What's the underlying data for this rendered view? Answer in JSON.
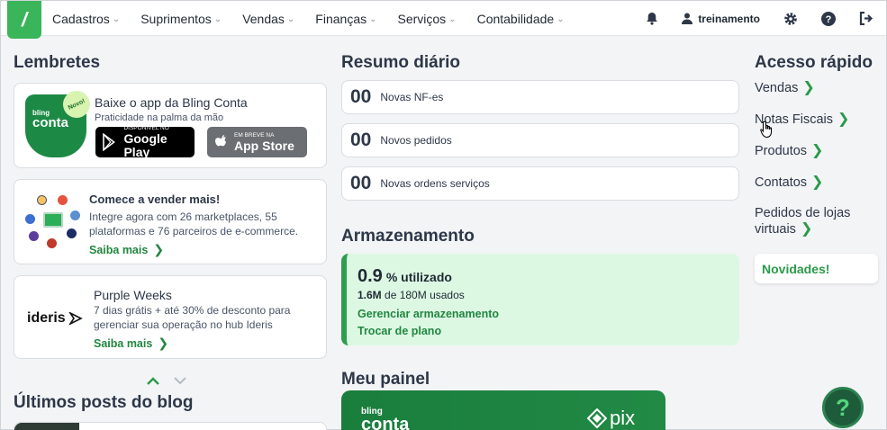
{
  "nav": {
    "items": [
      {
        "label": "Cadastros",
        "name": "nav-cadastros"
      },
      {
        "label": "Suprimentos",
        "name": "nav-suprimentos"
      },
      {
        "label": "Vendas",
        "name": "nav-vendas"
      },
      {
        "label": "Finanças",
        "name": "nav-financas"
      },
      {
        "label": "Serviços",
        "name": "nav-servicos"
      },
      {
        "label": "Contabilidade",
        "name": "nav-contabilidade"
      }
    ],
    "user": "treinamento",
    "icons": [
      "bell-icon",
      "user-icon",
      "gear-icon",
      "help-icon",
      "logout-icon"
    ]
  },
  "lembretes": {
    "title": "Lembretes",
    "app_card": {
      "title": "Baixe o app da Bling Conta",
      "subtitle": "Praticidade na palma da mão",
      "phone_small": "bling",
      "phone_big": "conta",
      "badge": "Novo!",
      "google_small": "DISPONÍVEL NO",
      "google_big": "Google Play",
      "apple_small": "EM BREVE NA",
      "apple_big": "App Store"
    },
    "sell_card": {
      "title": "Comece a vender mais!",
      "text": "Integre agora com 26 marketplaces, 55 plataformas e 76 parceiros de e-commerce.",
      "link": "Saiba mais"
    },
    "ideris_card": {
      "logo": "ideris",
      "title": "Purple Weeks",
      "text": "7 dias grátis + até 30% de desconto para gerenciar sua operação no hub Ideris",
      "link": "Saiba mais"
    }
  },
  "blog": {
    "title": "Últimos posts do blog"
  },
  "resumo": {
    "title": "Resumo diário",
    "items": [
      {
        "value": "00",
        "label": "Novas NF-es"
      },
      {
        "value": "00",
        "label": "Novos pedidos"
      },
      {
        "value": "00",
        "label": "Novas ordens serviços"
      }
    ]
  },
  "armazenamento": {
    "title": "Armazenamento",
    "percent": "0.9",
    "percent_label": "% utilizado",
    "used": "1.6M",
    "total_text": "de 180M usados",
    "manage_link": "Gerenciar armazenamento",
    "plan_link": "Trocar de plano"
  },
  "painel": {
    "title": "Meu painel",
    "banner_small": "bling",
    "banner_big": "conta",
    "banner_pix": "pix"
  },
  "acesso": {
    "title": "Acesso rápido",
    "links": [
      {
        "label": "Vendas",
        "name": "quick-vendas"
      },
      {
        "label": "Notas Fiscais",
        "name": "quick-notas-fiscais"
      },
      {
        "label": "Produtos",
        "name": "quick-produtos"
      },
      {
        "label": "Contatos",
        "name": "quick-contatos"
      },
      {
        "label": "Pedidos de lojas virtuais",
        "name": "quick-pedidos-lojas"
      }
    ],
    "novidades": "Novidades!"
  },
  "colors": {
    "brand_green": "#3ab55a",
    "link_green": "#21873f",
    "storage_bg": "#dcf8e3"
  }
}
